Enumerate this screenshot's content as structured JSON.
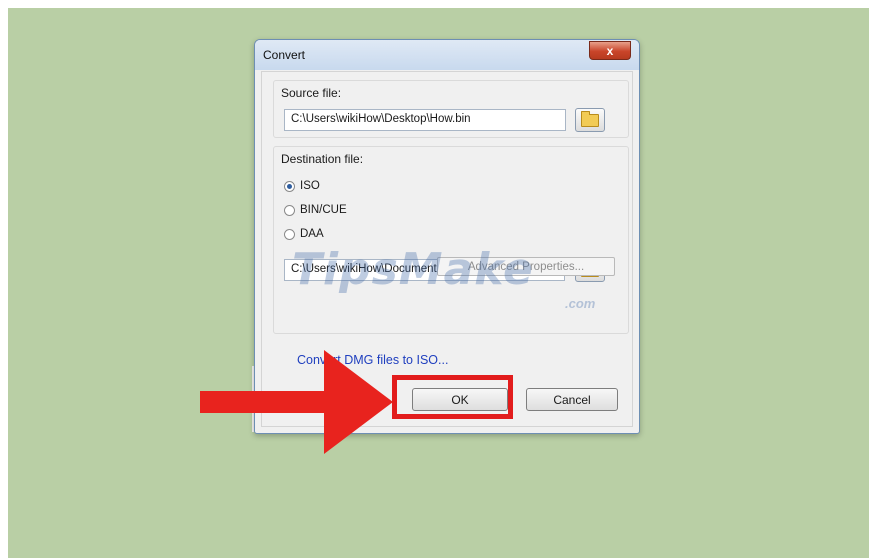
{
  "dialog": {
    "title": "Convert",
    "close_label": "x"
  },
  "source": {
    "label": "Source file:",
    "path": "C:\\Users\\wikiHow\\Desktop\\How.bin"
  },
  "destination": {
    "label": "Destination file:",
    "options": [
      {
        "label": "ISO",
        "checked": true
      },
      {
        "label": "BIN/CUE",
        "checked": false
      },
      {
        "label": "DAA",
        "checked": false
      }
    ],
    "advanced_label": "Advanced Properties...",
    "path": "C:\\Users\\wikiHow\\Documents\\How.iso"
  },
  "link": {
    "label": "Convert DMG files to ISO..."
  },
  "buttons": {
    "ok": "OK",
    "cancel": "Cancel"
  },
  "watermark": {
    "text": "TipsMake",
    "suffix": ".com"
  },
  "colors": {
    "background": "#b9cfa5",
    "highlight": "#e21c1c",
    "arrow": "#e8231e",
    "link": "#1f3fbf"
  },
  "icons": [
    "close-icon",
    "folder-icon",
    "arrow-pointer-icon"
  ]
}
